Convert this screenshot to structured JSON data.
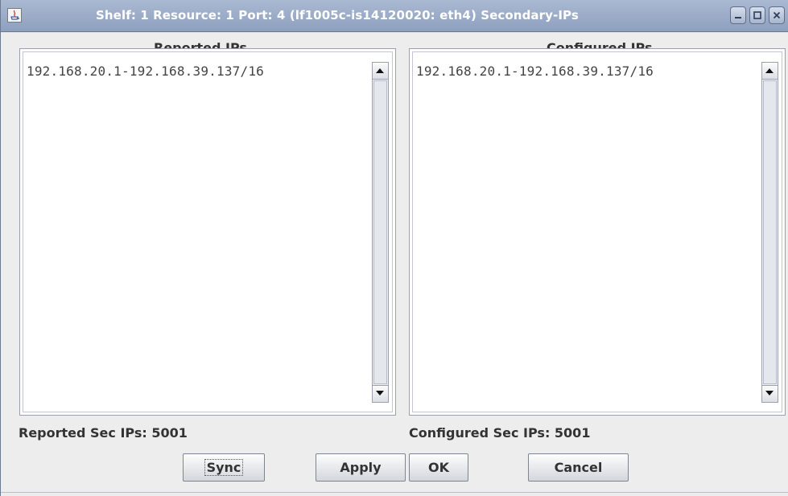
{
  "window": {
    "title": "Shelf: 1  Resource: 1  Port: 4  (lf1005c-is14120020: eth4)  Secondary-IPs",
    "controls": [
      "minimize-icon",
      "maximize-icon",
      "close-icon"
    ]
  },
  "reported": {
    "header": "Reported IPs",
    "items": [
      "192.168.20.1-192.168.39.137/16"
    ],
    "count_label": "Reported Sec IPs: 5001"
  },
  "configured": {
    "header": "Configured IPs",
    "items": [
      "192.168.20.1-192.168.39.137/16"
    ],
    "count_label": "Configured Sec IPs: 5001"
  },
  "buttons": {
    "sync": "Sync",
    "apply": "Apply",
    "ok": "OK",
    "cancel": "Cancel"
  },
  "colors": {
    "titlebar": "#8ea0bf",
    "window_bg": "#ededed"
  }
}
